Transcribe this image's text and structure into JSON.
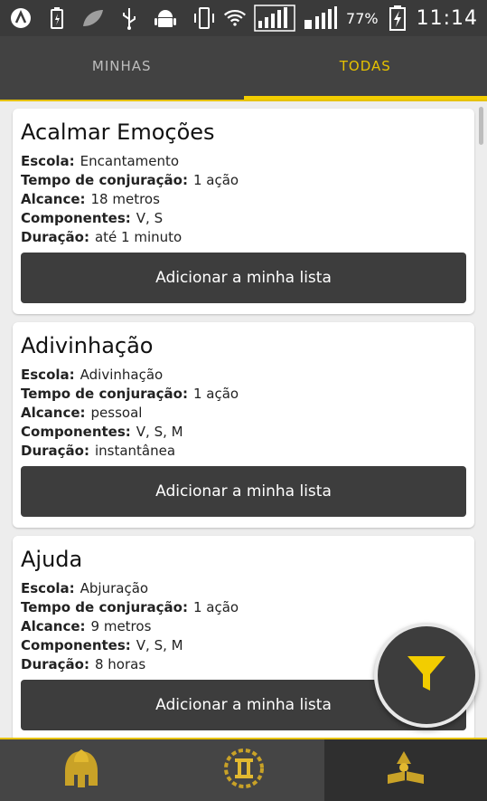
{
  "status_bar": {
    "battery_percent": "77%",
    "time": "11:14",
    "icons": [
      "a-icon",
      "battery-charging-icon",
      "leaf-icon",
      "usb-icon",
      "android-icon",
      "vibrate-icon",
      "wifi-icon",
      "signal-icon",
      "signal-2-icon",
      "charging-icon"
    ]
  },
  "tabs": [
    {
      "label": "MINHAS",
      "active": false
    },
    {
      "label": "TODAS",
      "active": true
    }
  ],
  "field_labels": {
    "school": "Escola:",
    "casting_time": "Tempo de conjuração:",
    "range": "Alcance:",
    "components": "Componentes:",
    "duration": "Duração:"
  },
  "spells": [
    {
      "name": "Acalmar Emoções",
      "school": "Encantamento",
      "casting_time": "1 ação",
      "range": "18 metros",
      "components": "V, S",
      "duration": "até 1 minuto",
      "button": "Adicionar a minha lista"
    },
    {
      "name": "Adivinhação",
      "school": "Adivinhação",
      "casting_time": "1 ação",
      "range": "pessoal",
      "components": "V, S, M",
      "duration": "instantânea",
      "button": "Adicionar a minha lista"
    },
    {
      "name": "Ajuda",
      "school": "Abjuração",
      "casting_time": "1 ação",
      "range": "9 metros",
      "components": "V, S, M",
      "duration": "8 horas",
      "button": "Adicionar a minha lista"
    }
  ],
  "fab": {
    "icon": "filter-icon"
  },
  "bottom_nav": [
    {
      "icon": "spartan-helmet-icon",
      "active": false
    },
    {
      "icon": "pillar-wreath-icon",
      "active": false
    },
    {
      "icon": "wizard-book-icon",
      "active": true
    }
  ],
  "colors": {
    "accent": "#f2cd00",
    "dark": "#3d3d3d",
    "background": "#ededed"
  }
}
